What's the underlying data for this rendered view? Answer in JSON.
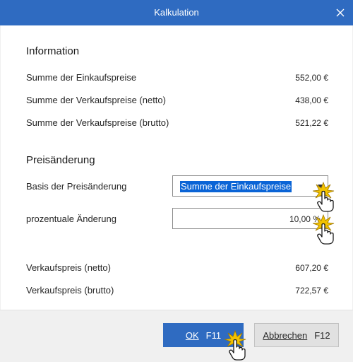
{
  "window": {
    "title": "Kalkulation"
  },
  "information": {
    "heading": "Information",
    "rows": [
      {
        "label": "Summe der Einkaufspreise",
        "value": "552,00 €"
      },
      {
        "label": "Summe der Verkaufspreise (netto)",
        "value": "438,00 €"
      },
      {
        "label": "Summe der Verkaufspreise (brutto)",
        "value": "521,22 €"
      }
    ]
  },
  "price_change": {
    "heading": "Preisänderung",
    "basis_label": "Basis der Preisänderung",
    "basis_value": "Summe der Einkaufspreise",
    "percent_label": "prozentuale Änderung",
    "percent_value": "10,00 %"
  },
  "results": [
    {
      "label": "Verkaufspreis (netto)",
      "value": "607,20 €"
    },
    {
      "label": "Verkaufspreis (brutto)",
      "value": "722,57 €"
    }
  ],
  "buttons": {
    "ok_label": "OK",
    "ok_key": "F11",
    "cancel_label": "Abbrechen",
    "cancel_key": "F12"
  },
  "colors": {
    "accent": "#2f6bc1",
    "selection": "#0a64d6",
    "cursor_highlight": "#f2c200"
  }
}
